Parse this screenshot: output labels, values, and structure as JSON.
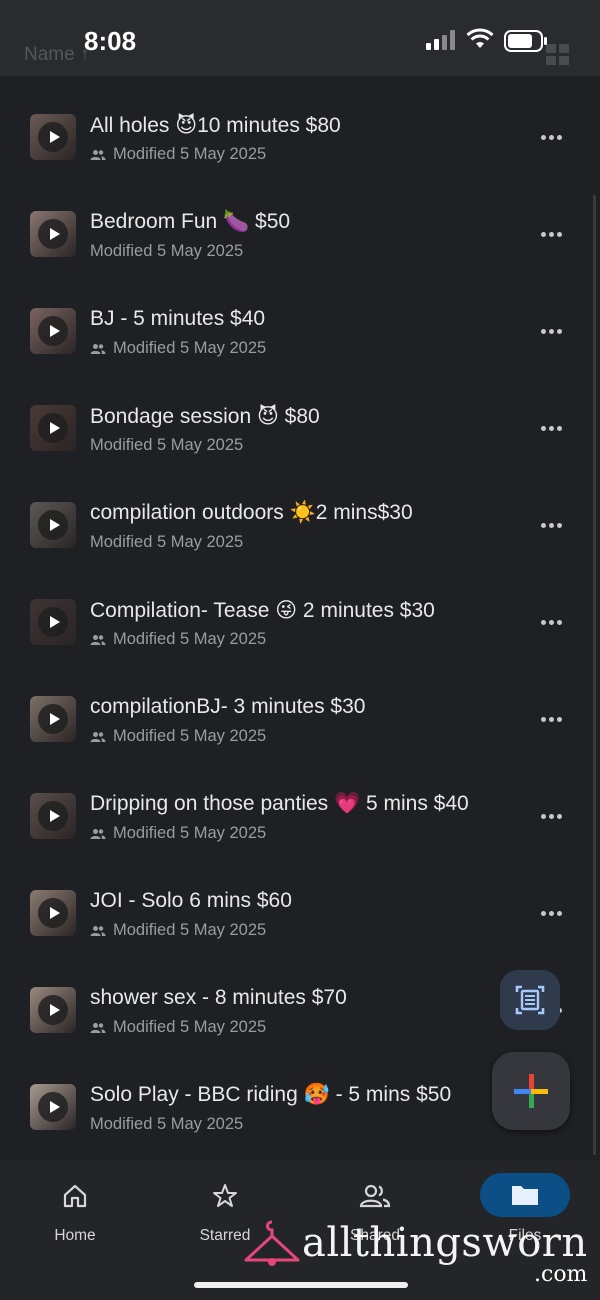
{
  "status_bar": {
    "time": "8:08"
  },
  "list_header": {
    "sort_label": "Name ↑"
  },
  "files": [
    {
      "title": "All holes 😈10 minutes $80",
      "modified": "Modified 5 May 2025",
      "shared": true
    },
    {
      "title": "Bedroom Fun 🍆 $50",
      "modified": "Modified 5 May 2025",
      "shared": false
    },
    {
      "title": "BJ - 5 minutes $40",
      "modified": "Modified 5 May 2025",
      "shared": true
    },
    {
      "title": "Bondage session 😈 $80",
      "modified": "Modified 5 May 2025",
      "shared": false
    },
    {
      "title": "compilation outdoors ☀️2 mins$30",
      "modified": "Modified 5 May 2025",
      "shared": false
    },
    {
      "title": "Compilation- Tease 😜 2  minutes $30",
      "modified": "Modified 5 May 2025",
      "shared": true
    },
    {
      "title": "compilationBJ- 3 minutes $30",
      "modified": "Modified 5 May 2025",
      "shared": true
    },
    {
      "title": "Dripping on those panties 💗 5 mins $40",
      "modified": "Modified 5 May 2025",
      "shared": true
    },
    {
      "title": "JOI - Solo 6 mins $60",
      "modified": "Modified 5 May 2025",
      "shared": true
    },
    {
      "title": "shower sex - 8 minutes $70",
      "modified": "Modified 5 May 2025",
      "shared": true
    },
    {
      "title": "Solo Play - BBC riding 🥵 - 5 mins $50",
      "modified": "Modified 5 May 2025",
      "shared": false
    }
  ],
  "bottom_nav": [
    {
      "label": "Home",
      "icon": "home-icon",
      "active": false
    },
    {
      "label": "Starred",
      "icon": "star-icon",
      "active": false
    },
    {
      "label": "Shared",
      "icon": "people-icon",
      "active": false
    },
    {
      "label": "Files",
      "icon": "folder-icon",
      "active": true
    }
  ],
  "watermark": {
    "text": "allthingsworn",
    "suffix": ".com"
  },
  "colors": {
    "background": "#1f2023",
    "accent_pill": "#0b4f86",
    "text_secondary": "#9b9ca0"
  }
}
